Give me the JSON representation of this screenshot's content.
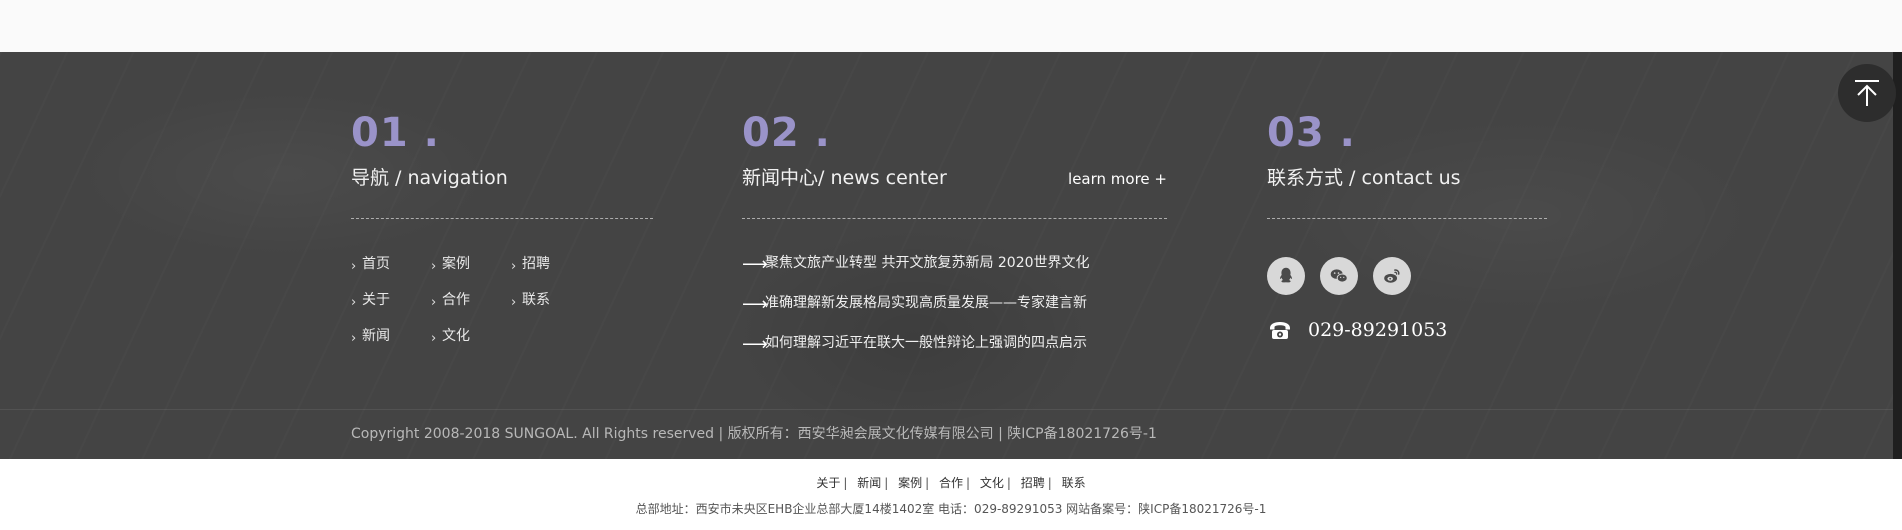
{
  "col1": {
    "num": "01 .",
    "title": "导航 / navigation",
    "links": [
      "首页",
      "案例",
      "招聘",
      "关于",
      "合作",
      "联系",
      "新闻",
      "文化"
    ]
  },
  "col2": {
    "num": "02 .",
    "title": "新闻中心/ news center",
    "learn_more": "learn more +",
    "news": [
      "聚焦文旅产业转型 共开文旅复苏新局 2020世界文化",
      "准确理解新发展格局实现高质量发展——专家建言新",
      "如何理解习近平在联大一般性辩论上强调的四点启示"
    ]
  },
  "col3": {
    "num": "03 .",
    "title": "联系方式 / contact us",
    "phone": "029-89291053",
    "social_icons": [
      "qq-icon",
      "wechat-icon",
      "weibo-icon"
    ]
  },
  "copyright": "Copyright 2008-2018 SUNGOAL. All Rights reserved | 版权所有：西安华昶会展文化传媒有限公司 | 陕ICP备18021726号-1",
  "bottom_links": [
    "关于",
    "新闻",
    "案例",
    "合作",
    "文化",
    "招聘",
    "联系"
  ],
  "address": "总部地址：西安市未央区EHB企业总部大厦14楼1402室 电话：029-89291053 网站备案号：陕ICP备18021726号-1",
  "colors": {
    "accent": "#9a93c9",
    "footer_bg": "#444444"
  }
}
